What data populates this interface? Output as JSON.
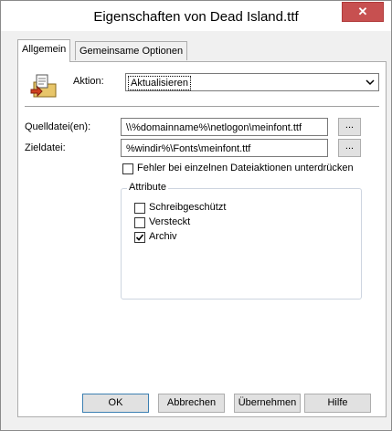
{
  "window": {
    "title": "Eigenschaften von Dead Island.ttf",
    "close_glyph": "✕"
  },
  "tabs": [
    {
      "label": "Allgemein",
      "active": true
    },
    {
      "label": "Gemeinsame Optionen",
      "active": false
    }
  ],
  "action": {
    "label": "Aktion:",
    "value": "Aktualisieren"
  },
  "source": {
    "label": "Quelldatei(en):",
    "value": "\\\\%domainname%\\netlogon\\meinfont.ttf",
    "browse": "..."
  },
  "target": {
    "label": "Zieldatei:",
    "value": "%windir%\\Fonts\\meinfont.ttf",
    "browse": "..."
  },
  "suppress_errors": {
    "label": "Fehler bei einzelnen Dateiaktionen unterdrücken",
    "checked": false
  },
  "attributes": {
    "title": "Attribute",
    "items": [
      {
        "label": "Schreibgeschützt",
        "checked": false
      },
      {
        "label": "Versteckt",
        "checked": false
      },
      {
        "label": "Archiv",
        "checked": true
      }
    ]
  },
  "buttons": {
    "ok": "OK",
    "cancel": "Abbrechen",
    "apply": "Übernehmen",
    "help": "Hilfe"
  },
  "colors": {
    "close_button": "#c75050",
    "panel_bg": "#ffffff",
    "dialog_bg": "#f0f0f0"
  },
  "icons": {
    "file-action": "file-folder-arrow-icon"
  }
}
